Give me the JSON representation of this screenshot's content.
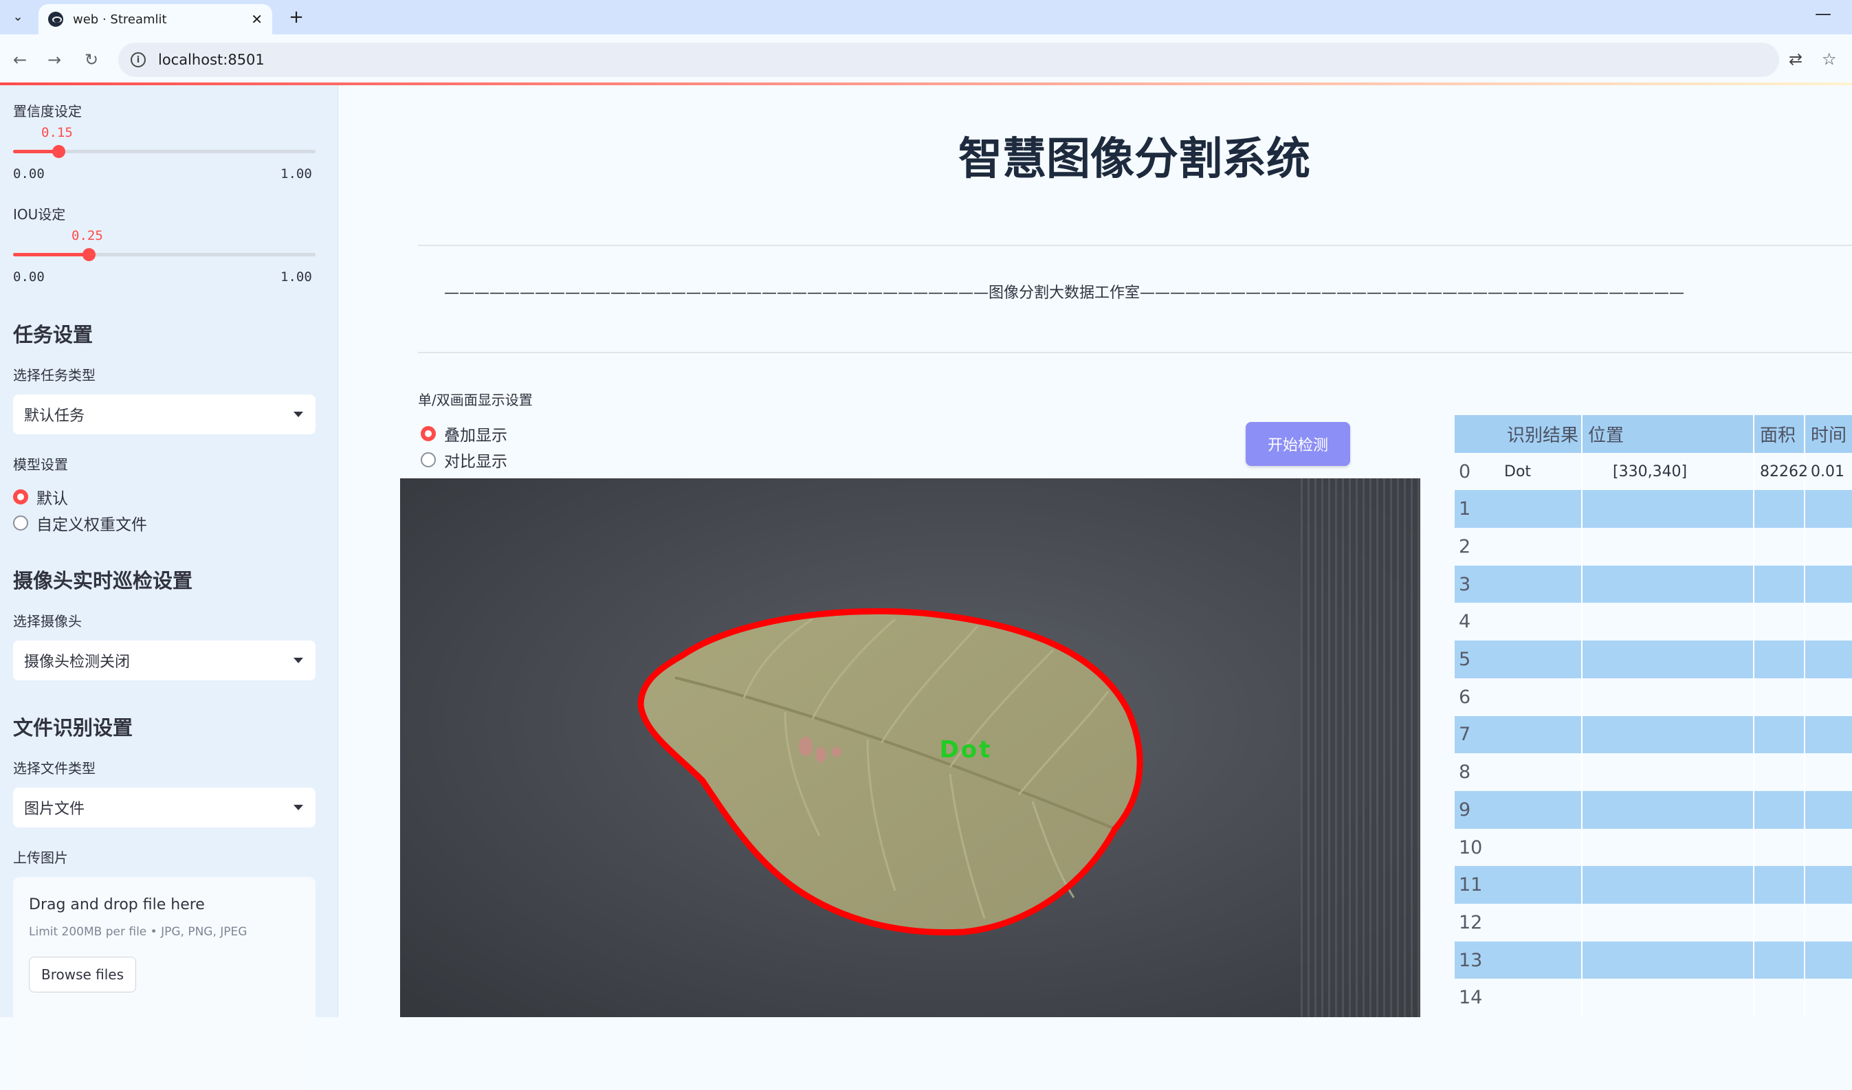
{
  "browser": {
    "tab_title": "web · Streamlit",
    "url": "localhost:8501"
  },
  "sidebar": {
    "confidence": {
      "label": "置信度设定",
      "value": "0.15",
      "fraction": 0.15,
      "min": "0.00",
      "max": "1.00"
    },
    "iou": {
      "label": "IOU设定",
      "value": "0.25",
      "fraction": 0.25,
      "min": "0.00",
      "max": "1.00"
    },
    "task_heading": "任务设置",
    "task_type_label": "选择任务类型",
    "task_type_value": "默认任务",
    "model_label": "模型设置",
    "model_options": [
      {
        "label": "默认",
        "selected": true
      },
      {
        "label": "自定义权重文件",
        "selected": false
      }
    ],
    "camera_heading": "摄像头实时巡检设置",
    "camera_label": "选择摄像头",
    "camera_value": "摄像头检测关闭",
    "file_heading": "文件识别设置",
    "file_type_label": "选择文件类型",
    "file_type_value": "图片文件",
    "upload_label": "上传图片",
    "upload": {
      "drop_text": "Drag and drop file here",
      "limit_text": "Limit 200MB per file • JPG, PNG, JPEG",
      "browse_label": "Browse files"
    }
  },
  "main": {
    "title": "智慧图像分割系统",
    "subtitle_line": "————————————————————————————————————图像分割大数据工作室————————————————————————————————————",
    "display_label": "单/双画面显示设置",
    "display_options": [
      {
        "label": "叠加显示",
        "selected": true
      },
      {
        "label": "对比显示",
        "selected": false
      }
    ],
    "start_button": "开始检测",
    "detection_label": "Dot"
  },
  "table": {
    "columns": [
      "识别结果",
      "位置",
      "面积",
      "时间"
    ],
    "rows": [
      {
        "index": "0",
        "result": "Dot",
        "position": "[330,340]",
        "area": "82262",
        "time": "0.01"
      },
      {
        "index": "1",
        "result": "",
        "position": "",
        "area": "",
        "time": ""
      },
      {
        "index": "2",
        "result": "",
        "position": "",
        "area": "",
        "time": ""
      },
      {
        "index": "3",
        "result": "",
        "position": "",
        "area": "",
        "time": ""
      },
      {
        "index": "4",
        "result": "",
        "position": "",
        "area": "",
        "time": ""
      },
      {
        "index": "5",
        "result": "",
        "position": "",
        "area": "",
        "time": ""
      },
      {
        "index": "6",
        "result": "",
        "position": "",
        "area": "",
        "time": ""
      },
      {
        "index": "7",
        "result": "",
        "position": "",
        "area": "",
        "time": ""
      },
      {
        "index": "8",
        "result": "",
        "position": "",
        "area": "",
        "time": ""
      },
      {
        "index": "9",
        "result": "",
        "position": "",
        "area": "",
        "time": ""
      },
      {
        "index": "10",
        "result": "",
        "position": "",
        "area": "",
        "time": ""
      },
      {
        "index": "11",
        "result": "",
        "position": "",
        "area": "",
        "time": ""
      },
      {
        "index": "12",
        "result": "",
        "position": "",
        "area": "",
        "time": ""
      },
      {
        "index": "13",
        "result": "",
        "position": "",
        "area": "",
        "time": ""
      },
      {
        "index": "14",
        "result": "",
        "position": "",
        "area": "",
        "time": ""
      }
    ]
  },
  "colors": {
    "accent": "#ff4b4b",
    "button": "#8c8ff5",
    "sidebar_bg": "#e6f1fb",
    "table_stripe": "#a8d3f5",
    "mask_outline": "#ff0000",
    "label_text": "#22cc22"
  }
}
